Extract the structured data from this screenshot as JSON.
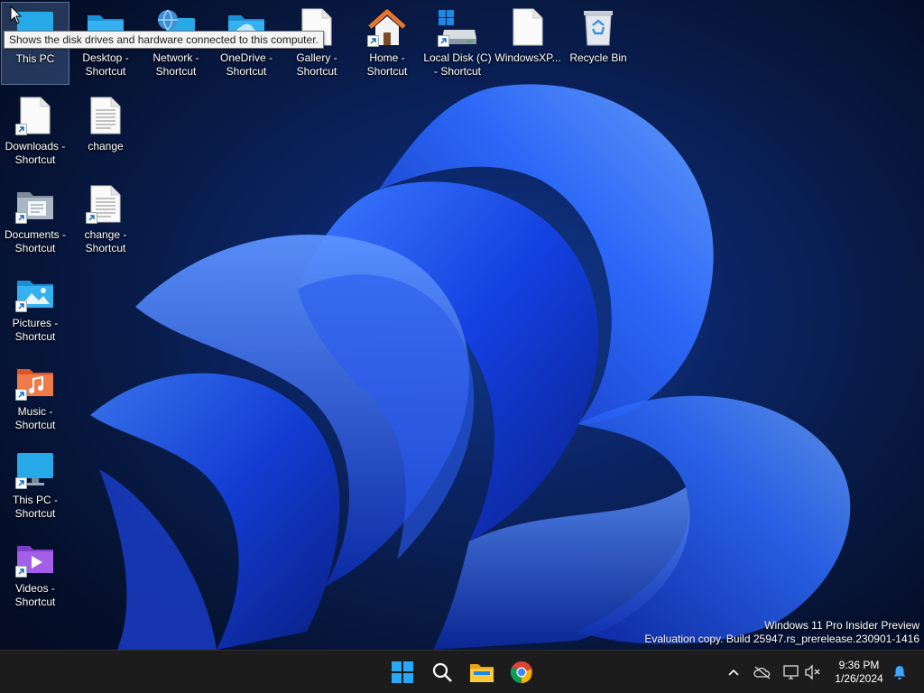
{
  "desktop": {
    "tooltip": "Shows the disk drives and hardware connected to this computer.",
    "icons": [
      {
        "label1": "This PC",
        "label2": ""
      },
      {
        "label1": "Desktop -",
        "label2": "Shortcut"
      },
      {
        "label1": "Network -",
        "label2": "Shortcut"
      },
      {
        "label1": "OneDrive -",
        "label2": "Shortcut"
      },
      {
        "label1": "Gallery -",
        "label2": "Shortcut"
      },
      {
        "label1": "Home -",
        "label2": "Shortcut"
      },
      {
        "label1": "Local Disk (C)",
        "label2": "- Shortcut"
      },
      {
        "label1": "WindowsXP...",
        "label2": ""
      },
      {
        "label1": "Recycle Bin",
        "label2": ""
      },
      {
        "label1": "Downloads -",
        "label2": "Shortcut"
      },
      {
        "label1": "change",
        "label2": ""
      },
      {
        "label1": "Documents -",
        "label2": "Shortcut"
      },
      {
        "label1": "change -",
        "label2": "Shortcut"
      },
      {
        "label1": "Pictures -",
        "label2": "Shortcut"
      },
      {
        "label1": "Music -",
        "label2": "Shortcut"
      },
      {
        "label1": "This PC -",
        "label2": "Shortcut"
      },
      {
        "label1": "Videos -",
        "label2": "Shortcut"
      }
    ]
  },
  "watermark": {
    "line1": "Windows 11 Pro Insider Preview",
    "line2": "Evaluation copy. Build 25947.rs_prerelease.230901-1416"
  },
  "taskbar": {
    "apps": [
      "start-icon",
      "search-icon",
      "file-explorer-icon",
      "chrome-icon"
    ],
    "tray": [
      "chevron-up-icon",
      "onedrive-offline-icon",
      "network-icon",
      "volume-muted-icon",
      "notification-bell-icon"
    ],
    "time": "9:36 PM",
    "date": "1/26/2024"
  },
  "colors": {
    "accent": "#0078d4",
    "taskbar_bg": "#1c1c1c",
    "folder_blue": "#2aa3e6"
  }
}
